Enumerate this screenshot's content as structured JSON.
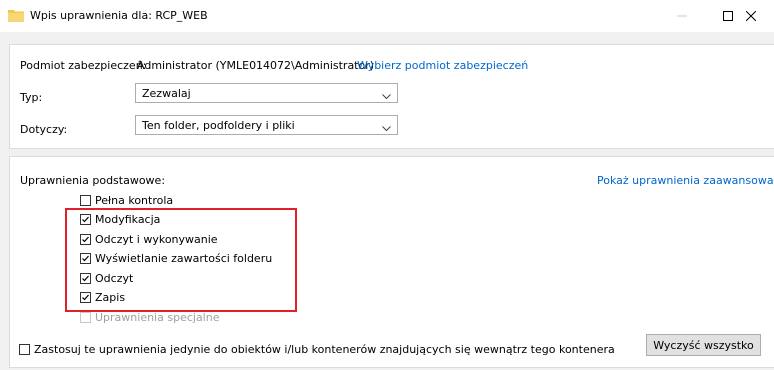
{
  "window": {
    "title": "Wpis uprawnienia dla: RCP_WEB",
    "folder_color": "#f2c94c"
  },
  "principal": {
    "label": "Podmiot zabezpieczeń:",
    "value": "Administrator (YMLE014072\\Administrator)",
    "select_link": "Wybierz podmiot zabezpieczeń"
  },
  "type": {
    "label": "Typ:",
    "value": "Zezwalaj"
  },
  "applies": {
    "label": "Dotyczy:",
    "value": "Ten folder, podfoldery i pliki"
  },
  "basic": {
    "label": "Uprawnienia podstawowe:",
    "advanced_link": "Pokaż uprawnienia zaawansowane",
    "items": [
      {
        "label": "Pełna kontrola",
        "checked": false,
        "disabled": false
      },
      {
        "label": "Modyfikacja",
        "checked": true,
        "disabled": false
      },
      {
        "label": "Odczyt i wykonywanie",
        "checked": true,
        "disabled": false
      },
      {
        "label": "Wyświetlanie zawartości folderu",
        "checked": true,
        "disabled": false
      },
      {
        "label": "Odczyt",
        "checked": true,
        "disabled": false
      },
      {
        "label": "Zapis",
        "checked": true,
        "disabled": false
      },
      {
        "label": "Uprawnienia specjalne",
        "checked": false,
        "disabled": true
      }
    ]
  },
  "apply_only": {
    "label": "Zastosuj te uprawnienia jedynie do obiektów i/lub kontenerów znajdujących się wewnątrz tego kontenera",
    "checked": false
  },
  "clear_button": "Wyczyść wszystko",
  "colors": {
    "link": "#0066cc",
    "highlight": "#e0202a"
  }
}
